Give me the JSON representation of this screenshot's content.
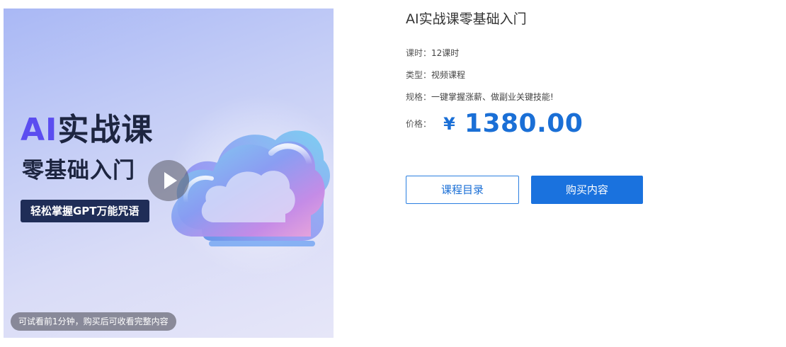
{
  "cover": {
    "title_ai": "AI",
    "title_rest": "实战课",
    "subtitle": "零基础入门",
    "tag": "轻松掌握GPT万能咒语",
    "trial_note": "可试看前1分钟，购买后可收看完整内容",
    "play_icon": "play-icon",
    "art": "glass-cloud-illustration"
  },
  "course": {
    "title": "AI实战课零基础入门",
    "hours_label": "课时：",
    "hours_value": "12课时",
    "type_label": "类型：",
    "type_value": "视频课程",
    "spec_label": "规格：",
    "spec_value": "一键掌握涨薪、做副业关键技能!",
    "price_label": "价格：",
    "price_currency": "¥",
    "price_value": "1380.00"
  },
  "buttons": {
    "catalog_label": "课程目录",
    "buy_label": "购买内容"
  },
  "colors": {
    "accent": "#1a6fd6",
    "cover_dark": "#1f2d57",
    "cover_ai": "#5b4df0"
  }
}
